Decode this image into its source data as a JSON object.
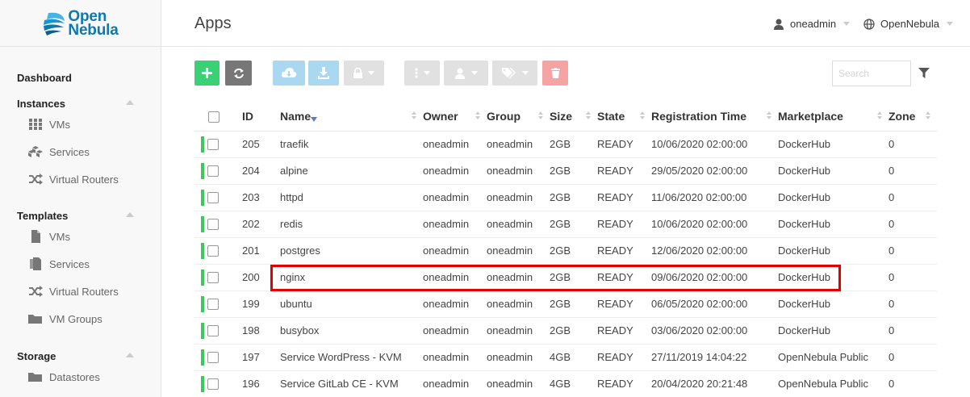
{
  "logo": {
    "line1": "Open",
    "line2": "Nebula"
  },
  "sidebar": {
    "sections": [
      {
        "title": "Dashboard"
      },
      {
        "title": "Instances",
        "items": [
          {
            "label": "VMs",
            "icon": "grid-icon"
          },
          {
            "label": "Services",
            "icon": "cubes-icon"
          },
          {
            "label": "Virtual Routers",
            "icon": "random-icon"
          }
        ]
      },
      {
        "title": "Templates",
        "items": [
          {
            "label": "VMs",
            "icon": "file-icon"
          },
          {
            "label": "Services",
            "icon": "files-icon"
          },
          {
            "label": "Virtual Routers",
            "icon": "random-icon"
          },
          {
            "label": "VM Groups",
            "icon": "folder-icon"
          }
        ]
      },
      {
        "title": "Storage",
        "items": [
          {
            "label": "Datastores",
            "icon": "folder-icon"
          }
        ]
      }
    ]
  },
  "header": {
    "title": "Apps",
    "user": "oneadmin",
    "zone": "OpenNebula"
  },
  "search": {
    "placeholder": "Search"
  },
  "colors": {
    "green": "#3cc85b",
    "primary_green": "#3ad175",
    "gray_btn": "#777777",
    "blue_light": "#a9d8f0",
    "red_light": "#f5a3a3",
    "disabled": "#e1e1e1",
    "highlight": "#e00000"
  },
  "table": {
    "columns": [
      "ID",
      "Name",
      "Owner",
      "Group",
      "Size",
      "State",
      "Registration Time",
      "Marketplace",
      "Zone"
    ],
    "rows": [
      {
        "id": "205",
        "name": "traefik",
        "owner": "oneadmin",
        "group": "oneadmin",
        "size": "2GB",
        "state": "READY",
        "time": "10/06/2020 02:00:00",
        "market": "DockerHub",
        "zone": "0"
      },
      {
        "id": "204",
        "name": "alpine",
        "owner": "oneadmin",
        "group": "oneadmin",
        "size": "2GB",
        "state": "READY",
        "time": "29/05/2020 02:00:00",
        "market": "DockerHub",
        "zone": "0"
      },
      {
        "id": "203",
        "name": "httpd",
        "owner": "oneadmin",
        "group": "oneadmin",
        "size": "2GB",
        "state": "READY",
        "time": "11/06/2020 02:00:00",
        "market": "DockerHub",
        "zone": "0"
      },
      {
        "id": "202",
        "name": "redis",
        "owner": "oneadmin",
        "group": "oneadmin",
        "size": "2GB",
        "state": "READY",
        "time": "10/06/2020 02:00:00",
        "market": "DockerHub",
        "zone": "0"
      },
      {
        "id": "201",
        "name": "postgres",
        "owner": "oneadmin",
        "group": "oneadmin",
        "size": "2GB",
        "state": "READY",
        "time": "12/06/2020 02:00:00",
        "market": "DockerHub",
        "zone": "0"
      },
      {
        "id": "200",
        "name": "nginx",
        "owner": "oneadmin",
        "group": "oneadmin",
        "size": "2GB",
        "state": "READY",
        "time": "09/06/2020 02:00:00",
        "market": "DockerHub",
        "zone": "0"
      },
      {
        "id": "199",
        "name": "ubuntu",
        "owner": "oneadmin",
        "group": "oneadmin",
        "size": "2GB",
        "state": "READY",
        "time": "06/05/2020 02:00:00",
        "market": "DockerHub",
        "zone": "0"
      },
      {
        "id": "198",
        "name": "busybox",
        "owner": "oneadmin",
        "group": "oneadmin",
        "size": "2GB",
        "state": "READY",
        "time": "03/06/2020 02:00:00",
        "market": "DockerHub",
        "zone": "0"
      },
      {
        "id": "197",
        "name": "Service WordPress - KVM",
        "owner": "oneadmin",
        "group": "oneadmin",
        "size": "4GB",
        "state": "READY",
        "time": "27/11/2019 14:04:22",
        "market": "OpenNebula Public",
        "zone": "0"
      },
      {
        "id": "196",
        "name": "Service GitLab CE - KVM",
        "owner": "oneadmin",
        "group": "oneadmin",
        "size": "4GB",
        "state": "READY",
        "time": "20/04/2020 20:21:48",
        "market": "OpenNebula Public",
        "zone": "0"
      }
    ]
  }
}
